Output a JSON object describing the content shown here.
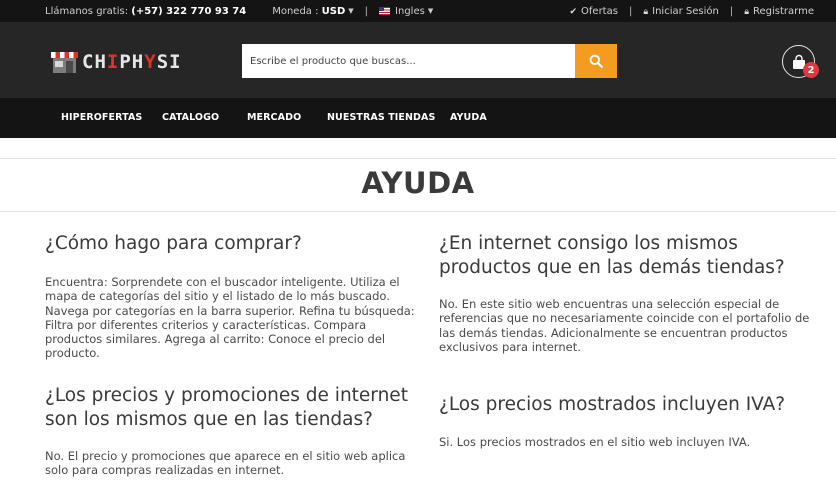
{
  "topbar": {
    "phone_label": "Llámanos gratis:",
    "phone_number": "(+57) 322 770 93 74",
    "currency_label": "Moneda :",
    "currency_value": "USD",
    "separator": "|",
    "language": "Ingles",
    "offers": "Ofertas",
    "login": "Iniciar Sesión",
    "register": "Registrarme"
  },
  "header": {
    "logo_prefix": "CH",
    "logo_red": "I",
    "logo_mid": "PH",
    "logo_red2": "Y",
    "logo_suffix": "SI",
    "search_placeholder": "Escribe el producto que buscas...",
    "cart_count": "2"
  },
  "nav": {
    "items": [
      "HIPEROFERTAS",
      "CATALOGO",
      "MERCADO",
      "NUESTRAS TIENDAS",
      "AYUDA"
    ]
  },
  "page": {
    "title": "AYUDA"
  },
  "faq": [
    {
      "question": "¿Cómo hago para comprar?",
      "answer": "Encuentra: Sorprendete con el buscador inteligente. Utiliza el mapa de categorías del sitio y el listado de lo más buscado. Navega por categorías en la barra superior. Refina tu búsqueda: Filtra por diferentes criterios y características. Compara productos similares. Agrega al carrito: Conoce el precio del producto."
    },
    {
      "question": "¿En internet consigo los mismos productos que en las demás tiendas?",
      "answer": "No. En este sitio web encuentras una selección especial de referencias que no necesariamente coincide con el portafolio de las demás tiendas. Adicionalmente se encuentran productos exclusivos para internet."
    },
    {
      "question": "¿Los precios y promociones de internet son los mismos que en las tiendas?",
      "answer": "No. El precio y promociones que aparece en el sitio web aplica solo para compras realizadas en internet."
    },
    {
      "question": "¿Los precios mostrados incluyen IVA?",
      "answer": "Si. Los precios mostrados en el sitio web incluyen IVA."
    }
  ],
  "colors": {
    "topbar_bg": "#141414",
    "header_bg": "#262626",
    "search_button": "#f39c1f",
    "badge": "#e0383e",
    "logo_accent": "#d9352b"
  }
}
